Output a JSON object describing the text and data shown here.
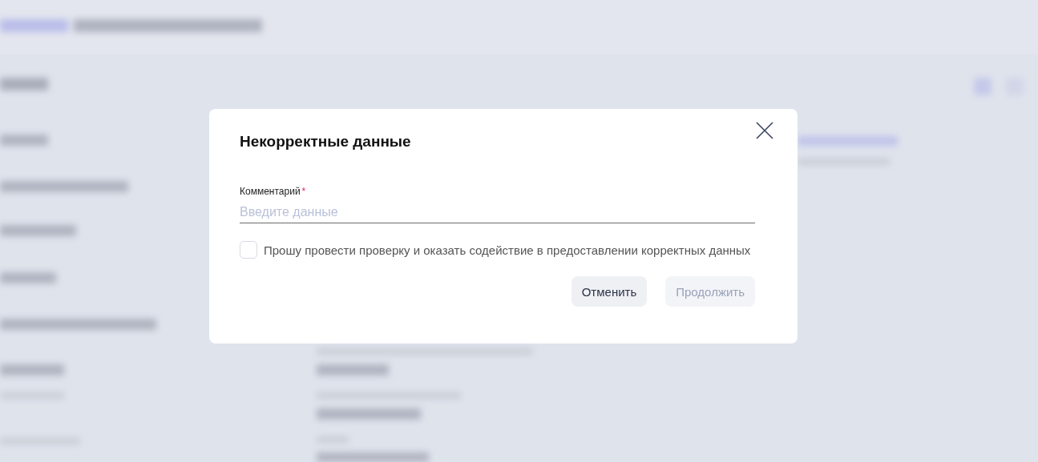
{
  "dialog": {
    "title": "Некорректные данные",
    "comment_field": {
      "label": "Комментарий",
      "required_mark": "*",
      "placeholder": "Введите данные"
    },
    "checkbox": {
      "label": "Прошу провести проверку и оказать содействие в предоставлении корректных данных",
      "checked": false
    },
    "buttons": [
      {
        "label": "Отменить",
        "disabled": false
      },
      {
        "label": "Продолжить",
        "disabled": true
      }
    ]
  }
}
